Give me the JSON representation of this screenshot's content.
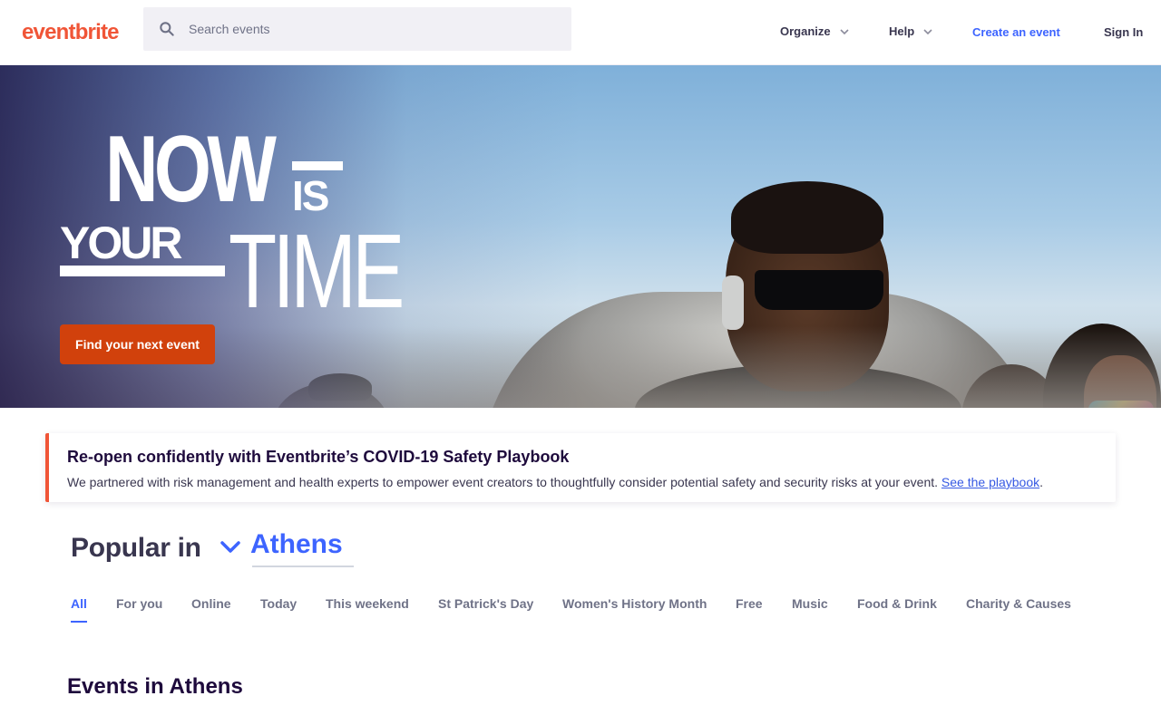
{
  "header": {
    "logo": "eventbrite",
    "search_placeholder": "Search events",
    "nav": {
      "organize": "Organize",
      "help": "Help",
      "create": "Create an event",
      "signin": "Sign In"
    }
  },
  "hero": {
    "title_now": "NOW",
    "title_is": "IS",
    "title_your": "YOUR",
    "title_time": "TIME",
    "cta": "Find your next event"
  },
  "banner": {
    "heading": "Re-open confidently with Eventbrite’s COVID-19 Safety Playbook",
    "text": "We partnered with risk management and health experts to empower event creators to thoughtfully consider potential safety and security risks at your event. ",
    "link": "See the playbook",
    "suffix": "."
  },
  "popular": {
    "label": "Popular in",
    "city": "Athens"
  },
  "tabs": [
    {
      "label": "All",
      "active": true
    },
    {
      "label": "For you"
    },
    {
      "label": "Online"
    },
    {
      "label": "Today"
    },
    {
      "label": "This weekend"
    },
    {
      "label": "St Patrick's Day"
    },
    {
      "label": "Women's History Month"
    },
    {
      "label": "Free"
    },
    {
      "label": "Music"
    },
    {
      "label": "Food & Drink"
    },
    {
      "label": "Charity & Causes"
    }
  ],
  "events": {
    "title": "Events in Athens"
  },
  "colors": {
    "brand": "#f05537",
    "cta": "#d1410c",
    "accent": "#3d64ff"
  }
}
